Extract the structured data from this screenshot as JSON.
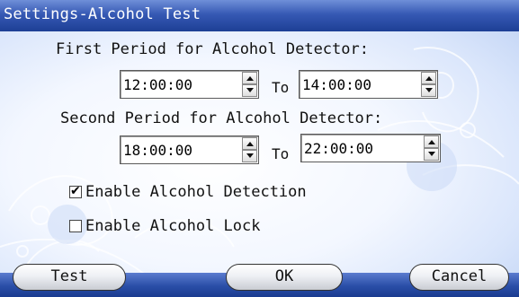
{
  "window": {
    "title": "Settings-Alcohol Test"
  },
  "first_period": {
    "label": "First Period for Alcohol Detector:",
    "from": "12:00:00",
    "to_label": "To",
    "to": "14:00:00"
  },
  "second_period": {
    "label": "Second Period for Alcohol Detector:",
    "from": "18:00:00",
    "to_label": "To",
    "to": "22:00:00"
  },
  "options": [
    {
      "label": "Enable Alcohol Detection",
      "checked": true,
      "mark": "✔"
    },
    {
      "label": "Enable Alcohol Lock",
      "checked": false,
      "mark": ""
    }
  ],
  "buttons": {
    "test": "Test",
    "ok": "OK",
    "cancel": "Cancel"
  },
  "colors": {
    "title_bar": "#1d3f95",
    "background": "#e6eefc",
    "button_face": "#eef0f4"
  }
}
